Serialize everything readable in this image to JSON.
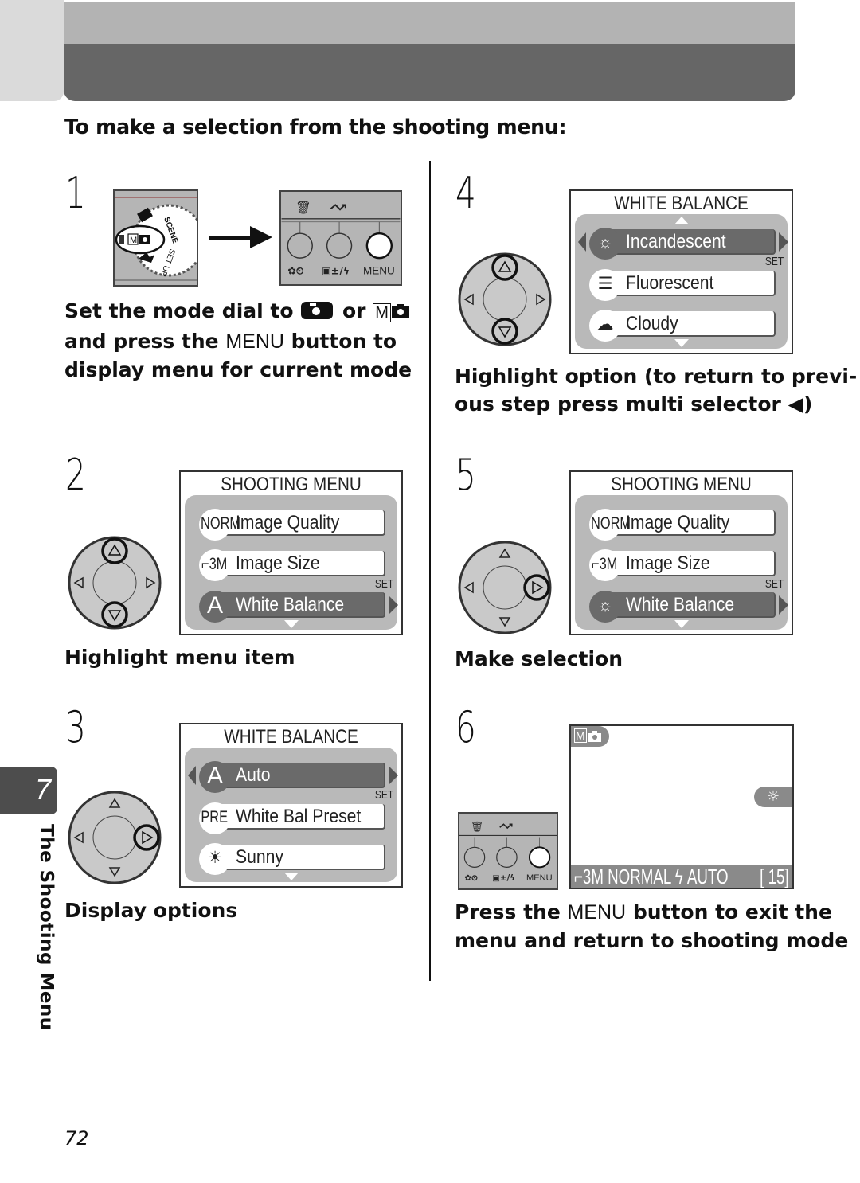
{
  "section_title": "To make a selection from the shooting menu:",
  "chapter": {
    "number": "7",
    "title": "The Shooting Menu"
  },
  "page_number": "72",
  "steps": [
    {
      "number": "1",
      "dial_labels": {
        "scene": "SCENE",
        "setup": "SET UP",
        "mode": "M"
      },
      "buttons": {
        "top_icons": [
          "trash-icon",
          "transfer-icon"
        ],
        "bottom_labels": [
          "✿⏲",
          "±/ϟ",
          "MENU"
        ]
      },
      "caption": {
        "part1": "Set the mode dial to",
        "mode_icon": "camera-icon",
        "part2": "or",
        "mode_m": "M",
        "part3": "and press the",
        "menu": "MENU",
        "part4": "button to display menu for current mode"
      }
    },
    {
      "number": "2",
      "screen": {
        "title": "SHOOTING MENU",
        "set": "SET",
        "rows": [
          {
            "icon": "NORM",
            "label": "Image Quality",
            "selected": false
          },
          {
            "icon": "⌐3M",
            "label": "Image Size",
            "selected": false
          },
          {
            "icon": "A",
            "label": "White Balance",
            "selected": true
          }
        ]
      },
      "caption": "Highlight menu item"
    },
    {
      "number": "3",
      "screen": {
        "title": "WHITE BALANCE",
        "set": "SET",
        "rows": [
          {
            "icon": "A",
            "label": "Auto",
            "selected": true
          },
          {
            "icon": "PRE",
            "label": "White Bal Preset",
            "selected": false
          },
          {
            "icon": "☀",
            "label": "Sunny",
            "selected": false
          }
        ]
      },
      "caption": "Display options"
    },
    {
      "number": "4",
      "screen": {
        "title": "WHITE BALANCE",
        "set": "SET",
        "rows": [
          {
            "icon": "☼",
            "label": "Incandescent",
            "selected": true
          },
          {
            "icon": "☰",
            "label": "Fluorescent",
            "selected": false
          },
          {
            "icon": "☁",
            "label": "Cloudy",
            "selected": false
          }
        ]
      },
      "caption": {
        "line1": "Highlight option (to return to previ-",
        "line2a": "ous step press multi selector",
        "arrow": "◀",
        "line2b": ")"
      }
    },
    {
      "number": "5",
      "screen": {
        "title": "SHOOTING MENU",
        "set": "SET",
        "rows": [
          {
            "icon": "NORM",
            "label": "Image Quality",
            "selected": false
          },
          {
            "icon": "⌐3M",
            "label": "Image Size",
            "selected": false
          },
          {
            "icon": "☼",
            "label": "White Balance",
            "selected": true
          }
        ]
      },
      "caption": "Make selection"
    },
    {
      "number": "6",
      "viewfinder": {
        "mode": "M",
        "wb_icon": "☼",
        "status_left": "⌐3M NORMAL ϟ AUTO",
        "status_right": "[ 15]"
      },
      "buttons": {
        "bottom_labels": [
          "✿⏲",
          "±/ϟ",
          "MENU"
        ]
      },
      "caption": {
        "part1": "Press the",
        "menu": "MENU",
        "part2": "button to exit the menu and return to shooting mode"
      }
    }
  ],
  "colors": {
    "header_light": "#b3b3b3",
    "header_dark": "#666666",
    "tab": "#4d4d4d",
    "lcd_panel": "#b9b9b9",
    "selected_row": "#6a6a6a"
  }
}
